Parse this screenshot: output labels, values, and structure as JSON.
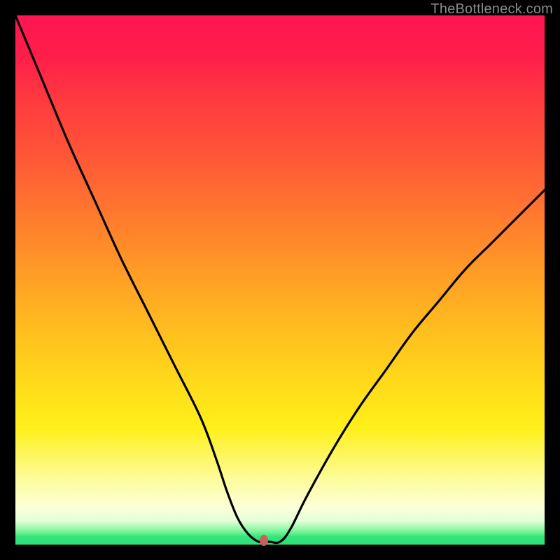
{
  "watermark": "TheBottleneck.com",
  "colors": {
    "background": "#000000",
    "gradient_top": "#ff1552",
    "gradient_mid1": "#ff7a2e",
    "gradient_mid2": "#ffd61a",
    "gradient_low": "#fdffd8",
    "gradient_bottom": "#2de078",
    "curve": "#000000",
    "marker": "#c9605a"
  },
  "chart_data": {
    "type": "line",
    "title": "",
    "xlabel": "",
    "ylabel": "",
    "xlim": [
      0,
      100
    ],
    "ylim": [
      0,
      100
    ],
    "x": [
      0,
      5,
      10,
      15,
      20,
      25,
      30,
      35,
      38,
      40,
      42,
      44,
      46,
      48,
      50,
      52,
      55,
      60,
      65,
      70,
      75,
      80,
      85,
      90,
      95,
      100
    ],
    "values": [
      100,
      88,
      76,
      65,
      54,
      44,
      34,
      24,
      16,
      10,
      5,
      2,
      0,
      0,
      0,
      3,
      9,
      18,
      26,
      33,
      40,
      46,
      52,
      57,
      62,
      67
    ],
    "marker": {
      "x": 47,
      "y": 0
    },
    "annotations": []
  }
}
